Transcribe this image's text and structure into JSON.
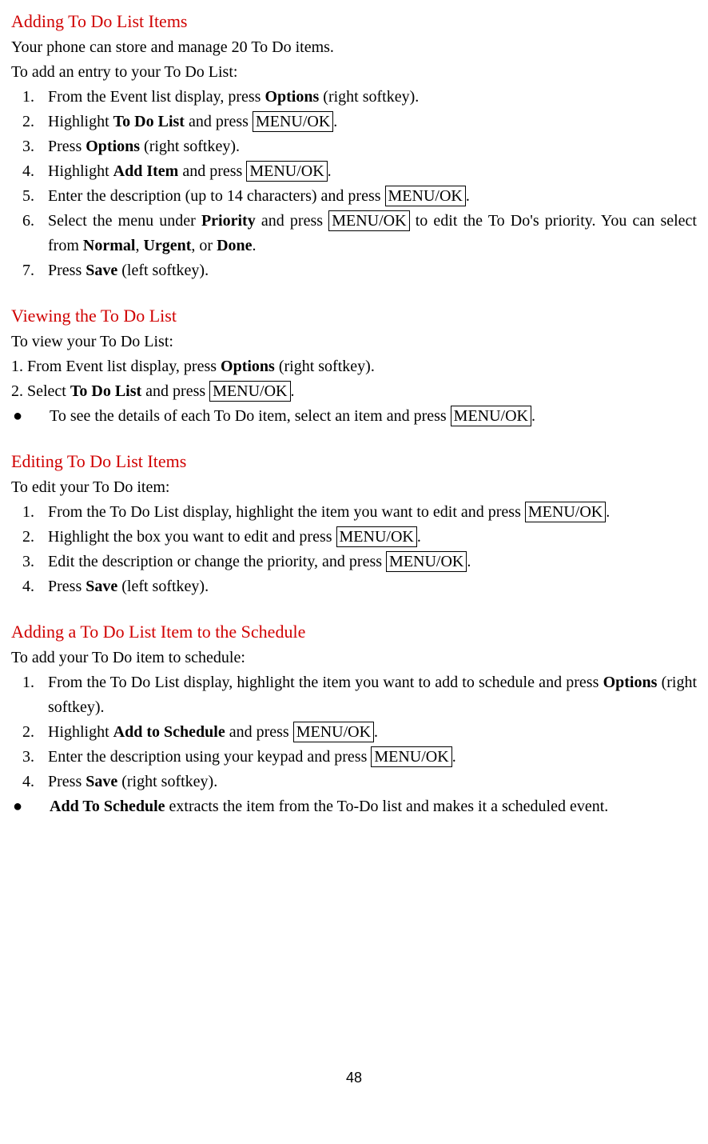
{
  "s1": {
    "heading": "Adding To Do List Items",
    "intro1": "Your phone can store and manage 20 To Do items.",
    "intro2": "To add an entry to your To Do List:",
    "i1_a": "From the Event list display, press ",
    "i1_b": "Options",
    "i1_c": " (right softkey).",
    "i2_a": "Highlight ",
    "i2_b": "To Do List",
    "i2_c": " and press ",
    "i2_d": "MENU/OK",
    "i2_e": ".",
    "i3_a": "Press ",
    "i3_b": "Options",
    "i3_c": " (right softkey).",
    "i4_a": "Highlight ",
    "i4_b": "Add Item",
    "i4_c": " and press ",
    "i4_d": "MENU/OK",
    "i4_e": ".",
    "i5_a": "Enter the description (up to 14 characters) and press ",
    "i5_b": "MENU/OK",
    "i5_c": ".",
    "i6_a": "Select the menu under ",
    "i6_b": "Priority",
    "i6_c": " and press ",
    "i6_d": "MENU/OK",
    "i6_e": " to edit the To Do's priority. You can select from ",
    "i6_f": "Normal",
    "i6_g": ", ",
    "i6_h": "Urgent",
    "i6_i": ", or ",
    "i6_j": "Done",
    "i6_k": ".",
    "i7_a": "Press ",
    "i7_b": "Save",
    "i7_c": " (left softkey)."
  },
  "s2": {
    "heading": "Viewing the To Do List",
    "intro": "To view your To Do List:",
    "l1_a": "1. From Event list display, press ",
    "l1_b": "Options",
    "l1_c": " (right softkey).",
    "l2_a": "2. Select ",
    "l2_b": "To Do List",
    "l2_c": " and press ",
    "l2_d": "MENU/OK",
    "l2_e": ".",
    "b1_a": "To see the details of each To Do item, select an item and press ",
    "b1_b": "MENU/OK",
    "b1_c": "."
  },
  "s3": {
    "heading": "Editing To Do List Items",
    "intro": "To edit your To Do item:",
    "i1_a": "From the To Do List display, highlight the item you want to edit and press ",
    "i1_b": "MENU/OK",
    "i1_c": ".",
    "i2_a": "Highlight the box you want to edit and press ",
    "i2_b": "MENU/OK",
    "i2_c": ".",
    "i3_a": "Edit the description or change the priority, and press ",
    "i3_b": "MENU/OK",
    "i3_c": ".",
    "i4_a": "Press ",
    "i4_b": "Save",
    "i4_c": " (left softkey)."
  },
  "s4": {
    "heading": "Adding a To Do List Item to the Schedule",
    "intro": "To add your To Do item to schedule:",
    "i1_a": "From the To Do List display, highlight the item you want to add to schedule and press ",
    "i1_b": "Options",
    "i1_c": " (right softkey).",
    "i2_a": "Highlight ",
    "i2_b": "Add to Schedule",
    "i2_c": " and press ",
    "i2_d": "MENU/OK",
    "i2_e": ".",
    "i3_a": "Enter the description using your keypad and press ",
    "i3_b": "MENU/OK",
    "i3_c": ".",
    "i4_a": "Press ",
    "i4_b": "Save",
    "i4_c": " (right softkey).",
    "b1_a": "Add To Schedule",
    "b1_b": " extracts the item from the To-Do list and makes it a scheduled event."
  },
  "bullet": "●",
  "pagenum": "48"
}
